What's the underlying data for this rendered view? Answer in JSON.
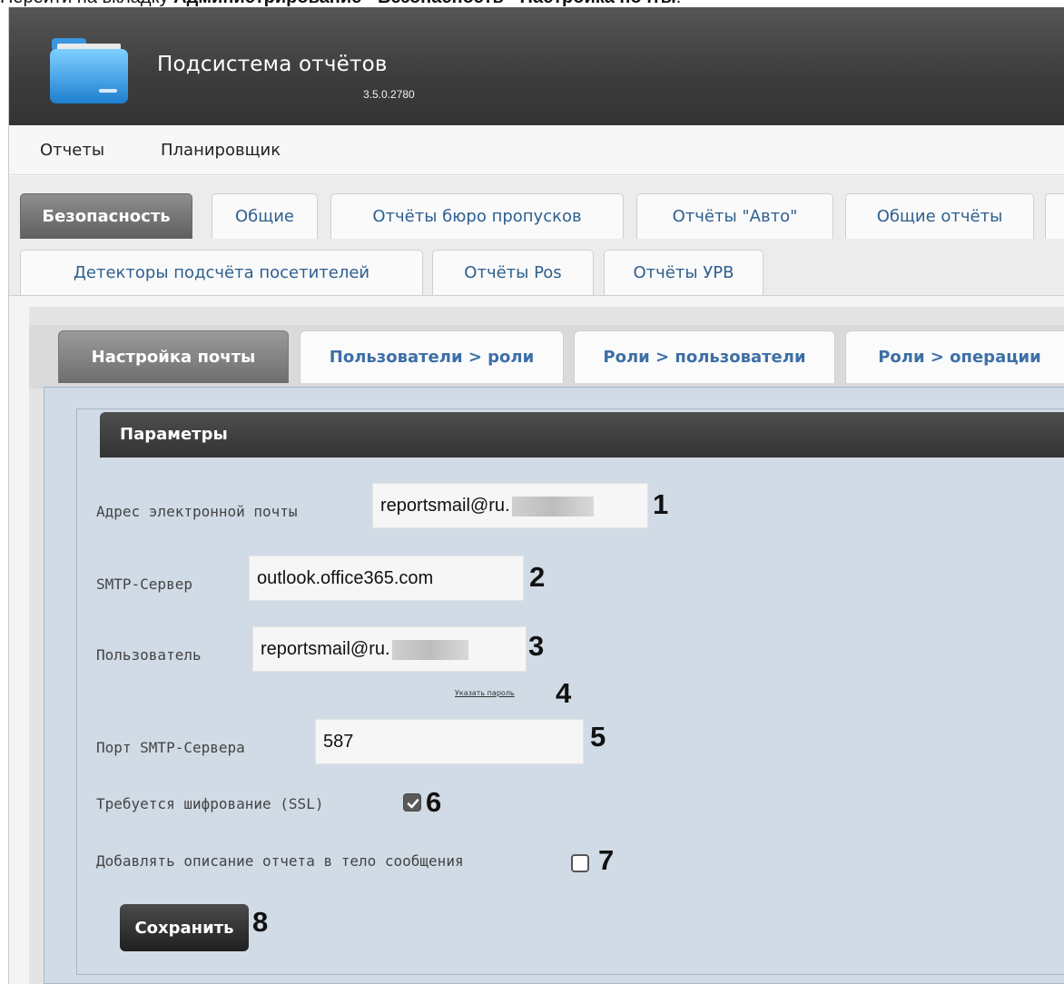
{
  "intro": {
    "prefix": "Перейти на вкладку ",
    "path": "Администрирование - Безопасность - Настройка почты",
    "suffix": "."
  },
  "header": {
    "title": "Подсистема отчётов",
    "version": "3.5.0.2780",
    "logo_icon": "folder-icon"
  },
  "menu": {
    "items": [
      "Отчеты",
      "Планировщик"
    ]
  },
  "main_tabs": {
    "active": "Безопасность",
    "row1": [
      "Безопасность",
      "Общие",
      "Отчёты бюро пропусков",
      "Отчёты \"Авто\"",
      "Общие отчёты"
    ],
    "row2": [
      "Детекторы подсчёта посетителей",
      "Отчёты Pos",
      "Отчёты УРВ"
    ]
  },
  "sub_tabs": {
    "active": "Настройка почты",
    "items": [
      "Настройка почты",
      "Пользователи > роли",
      "Роли > пользователи",
      "Роли > операции"
    ]
  },
  "params": {
    "title": "Параметры",
    "email_label": "Адрес электронной почты",
    "email_value": "reportsmail@ru.",
    "smtp_label": "SMTP-Сервер",
    "smtp_value": "outlook.office365.com",
    "user_label": "Пользователь",
    "user_value": "reportsmail@ru.",
    "password_link": "Указать пароль",
    "port_label": "Порт SMTP-Сервера",
    "port_value": "587",
    "ssl_label": "Требуется шифрование (SSL)",
    "ssl_checked": true,
    "desc_label": "Добавлять описание отчета в тело сообщения",
    "desc_checked": false,
    "save_label": "Сохранить"
  },
  "callouts": [
    "1",
    "2",
    "3",
    "4",
    "5",
    "6",
    "7",
    "8"
  ]
}
